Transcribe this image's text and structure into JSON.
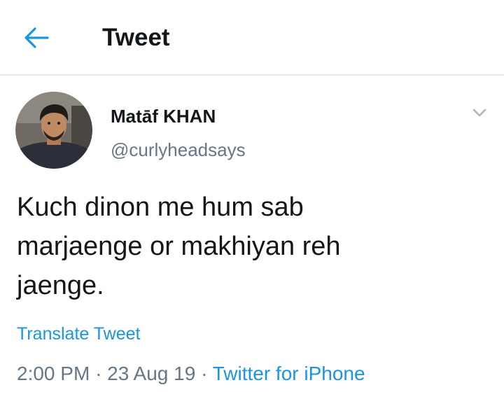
{
  "header": {
    "title": "Tweet",
    "back_icon": "arrow-left-icon"
  },
  "author": {
    "display_name": "Matāf KHAN",
    "handle": "@curlyheadsays",
    "avatar": "profile-photo"
  },
  "tweet": {
    "text": "Kuch dinon me hum sab\nmarjaenge or makhiyan reh\njaenge.",
    "translate_label": "Translate Tweet",
    "time": "2:00 PM",
    "separator": "·",
    "date": "23 Aug 19",
    "source": "Twitter for iPhone",
    "menu_icon": "chevron-down-icon"
  },
  "colors": {
    "accent": "#1b95e0",
    "text": "#14171a",
    "secondary": "#657786",
    "divider": "#e6ecf0"
  }
}
